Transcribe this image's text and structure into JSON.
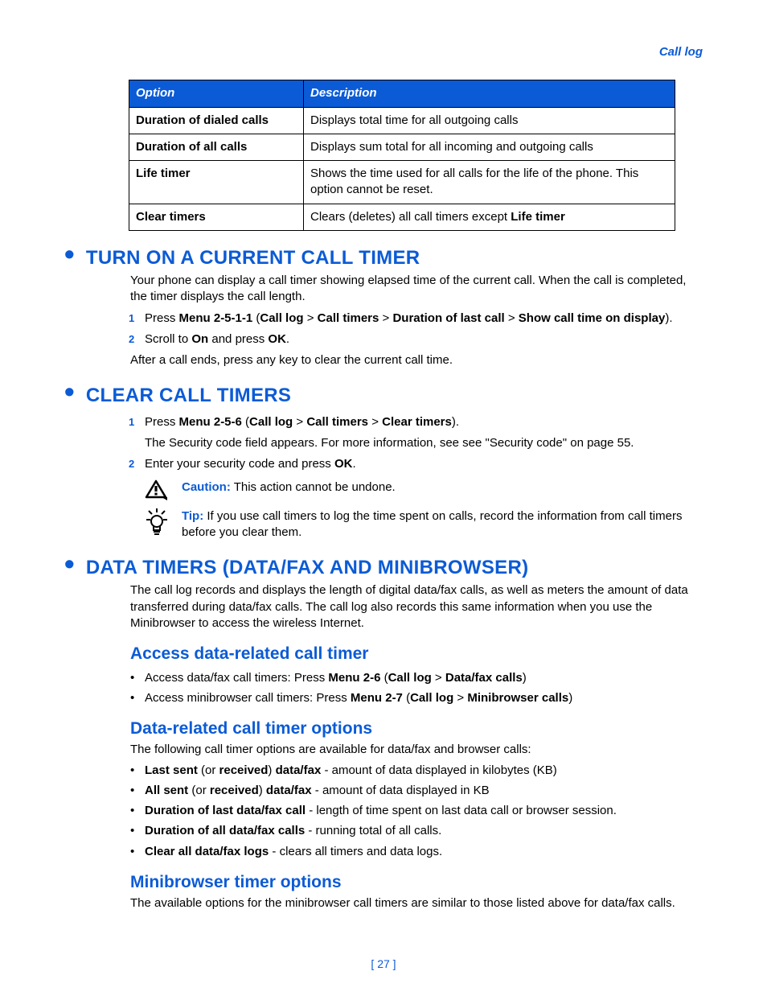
{
  "header": {
    "section": "Call log"
  },
  "table": {
    "headers": [
      "Option",
      "Description"
    ],
    "rows": [
      {
        "option": "Duration of dialed calls",
        "desc_before": "Displays total time for all outgoing calls",
        "desc_bold": "",
        "desc_after": ""
      },
      {
        "option": "Duration of all calls",
        "desc_before": "Displays sum total for all incoming and outgoing calls",
        "desc_bold": "",
        "desc_after": ""
      },
      {
        "option": "Life timer",
        "desc_before": "Shows the time used for all calls for the life of the phone. This option cannot be reset.",
        "desc_bold": "",
        "desc_after": ""
      },
      {
        "option": "Clear timers",
        "desc_before": "Clears (deletes) all call timers except ",
        "desc_bold": "Life timer",
        "desc_after": ""
      }
    ]
  },
  "sec1": {
    "title": "TURN ON A CURRENT CALL TIMER",
    "intro": "Your phone can display a call timer showing elapsed time of the current call. When the call is completed, the timer displays the call length.",
    "step1_pre": "Press ",
    "step1_b1": "Menu 2-5-1-1",
    "step1_mid1": " (",
    "step1_b2": "Call log",
    "step1_gt1": " > ",
    "step1_b3": "Call timers",
    "step1_gt2": " > ",
    "step1_b4": "Duration of last call",
    "step1_gt3": " > ",
    "step1_b5": "Show call time on display",
    "step1_post": ").",
    "step2_pre": "Scroll to ",
    "step2_b1": "On",
    "step2_mid": " and press ",
    "step2_b2": "OK",
    "step2_post": ".",
    "after": "After a call ends, press any key to clear the current call time."
  },
  "sec2": {
    "title": "CLEAR CALL TIMERS",
    "step1_pre": "Press ",
    "step1_b1": "Menu 2-5-6",
    "step1_mid1": " (",
    "step1_b2": "Call log",
    "step1_gt1": " > ",
    "step1_b3": "Call timers",
    "step1_gt2": " > ",
    "step1_b4": "Clear timers",
    "step1_post": ").",
    "step1_sub": "The Security code field appears. For more information, see see \"Security code\" on page 55.",
    "step2_pre": "Enter your security code and press ",
    "step2_b1": "OK",
    "step2_post": ".",
    "caution_label": "Caution:",
    "caution_text": " This action cannot be undone.",
    "tip_label": "Tip:",
    "tip_text": " If you use call timers to log the time spent on calls, record the information from call timers before you clear them."
  },
  "sec3": {
    "title": "DATA TIMERS (DATA/FAX AND MINIBROWSER)",
    "intro": "The call log records and displays the length of digital data/fax calls, as well as meters the amount of data transferred during data/fax calls. The call log also records this same information when you use the Minibrowser to access the wireless Internet.",
    "sub1": {
      "title": "Access data-related call timer",
      "li1_pre": "Access data/fax call timers: Press ",
      "li1_b1": "Menu 2-6",
      "li1_mid": " (",
      "li1_b2": "Call log",
      "li1_gt": " > ",
      "li1_b3": "Data/fax calls",
      "li1_post": ")",
      "li2_pre": "Access minibrowser call timers: Press ",
      "li2_b1": "Menu 2-7",
      "li2_mid": " (",
      "li2_b2": "Call log",
      "li2_gt": " > ",
      "li2_b3": "Minibrowser calls",
      "li2_post": ")"
    },
    "sub2": {
      "title": "Data-related call timer options",
      "intro": "The following call timer options are available for data/fax and browser calls:",
      "li1_b1": "Last sent",
      "li1_t1": " (or ",
      "li1_b2": "received",
      "li1_t2": ") ",
      "li1_b3": "data/fax",
      "li1_t3": " - amount of data displayed in kilobytes (KB)",
      "li2_b1": "All sent",
      "li2_t1": " (or ",
      "li2_b2": "received",
      "li2_t2": ") ",
      "li2_b3": "data/fax",
      "li2_t3": " - amount of data displayed in KB",
      "li3_b1": "Duration of last data/fax call",
      "li3_t1": " - length of time spent on last data call or browser session.",
      "li4_b1": "Duration of all data/fax calls",
      "li4_t1": " - running total of all calls.",
      "li5_b1": "Clear all data/fax logs",
      "li5_t1": " - clears all timers and data logs."
    },
    "sub3": {
      "title": "Minibrowser timer options",
      "text": "The available options for the minibrowser call timers are similar to those listed above for data/fax calls."
    }
  },
  "pagenum": "[ 27 ]"
}
